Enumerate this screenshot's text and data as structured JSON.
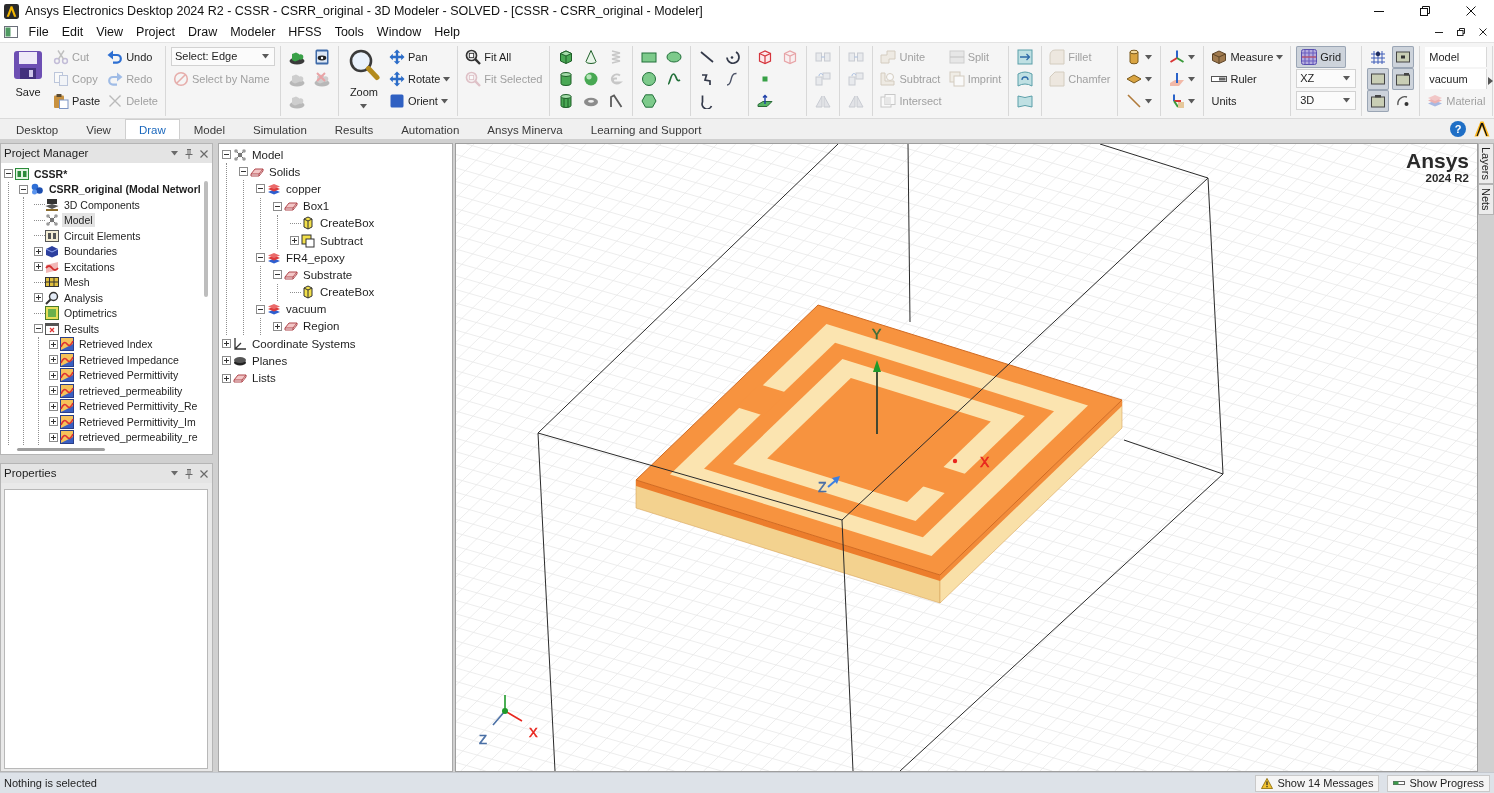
{
  "window": {
    "title": "Ansys Electronics Desktop 2024 R2 - CSSR - CSRR_original - 3D Modeler - SOLVED - [CSSR - CSRR_original - Modeler]"
  },
  "menu": [
    "File",
    "Edit",
    "View",
    "Project",
    "Draw",
    "Modeler",
    "HFSS",
    "Tools",
    "Window",
    "Help"
  ],
  "ribbon": [
    {
      "columns": [
        [
          {
            "kind": "large",
            "label": "Save",
            "disabled": false
          }
        ],
        [
          {
            "kind": "small",
            "label": "Cut",
            "disabled": true
          },
          {
            "kind": "small",
            "label": "Copy",
            "disabled": true
          },
          {
            "kind": "small",
            "label": "Paste",
            "disabled": false
          }
        ],
        [
          {
            "kind": "small",
            "label": "Undo",
            "disabled": false
          },
          {
            "kind": "small",
            "label": "Redo",
            "disabled": true
          },
          {
            "kind": "small",
            "label": "Delete",
            "disabled": true
          }
        ]
      ]
    },
    {
      "columns": [
        [
          {
            "kind": "select",
            "value": "Select: Edge"
          },
          {
            "kind": "small",
            "label": "Select by Name",
            "disabled": true
          }
        ]
      ]
    },
    {
      "columns": [
        [
          {
            "kind": "icon",
            "disabled": false
          },
          {
            "kind": "icon",
            "disabled": true
          },
          {
            "kind": "icon",
            "disabled": true
          }
        ],
        [
          {
            "kind": "icon",
            "disabled": false
          },
          {
            "kind": "icon",
            "disabled": true
          }
        ]
      ]
    },
    {
      "columns": [
        [
          {
            "kind": "large",
            "label": "Zoom",
            "disabled": false,
            "dropdown": true
          }
        ],
        [
          {
            "kind": "small",
            "label": "Pan",
            "disabled": false
          },
          {
            "kind": "small",
            "label": "Rotate",
            "disabled": false,
            "dropdown": true
          },
          {
            "kind": "small",
            "label": "Orient",
            "disabled": false,
            "dropdown": true
          }
        ]
      ]
    },
    {
      "columns": [
        [
          {
            "kind": "small",
            "label": "Fit All",
            "disabled": false
          },
          {
            "kind": "small",
            "label": "Fit Selected",
            "disabled": true
          }
        ]
      ]
    },
    {
      "columns": [
        [
          {
            "kind": "icon",
            "disabled": false
          },
          {
            "kind": "icon",
            "disabled": false
          },
          {
            "kind": "icon",
            "disabled": false
          }
        ],
        [
          {
            "kind": "icon",
            "disabled": false
          },
          {
            "kind": "icon",
            "disabled": false
          },
          {
            "kind": "icon",
            "disabled": false
          }
        ],
        [
          {
            "kind": "icon",
            "disabled": true
          },
          {
            "kind": "icon",
            "disabled": true
          },
          {
            "kind": "icon",
            "disabled": false
          }
        ]
      ]
    },
    {
      "columns": [
        [
          {
            "kind": "icon",
            "disabled": false
          },
          {
            "kind": "icon",
            "disabled": false
          },
          {
            "kind": "icon",
            "disabled": false
          }
        ],
        [
          {
            "kind": "icon",
            "disabled": false
          },
          {
            "kind": "icon",
            "disabled": false
          }
        ]
      ]
    },
    {
      "columns": [
        [
          {
            "kind": "icon",
            "disabled": false
          },
          {
            "kind": "icon",
            "disabled": false
          },
          {
            "kind": "icon",
            "disabled": false
          }
        ],
        [
          {
            "kind": "icon",
            "disabled": false
          },
          {
            "kind": "icon",
            "disabled": false
          }
        ]
      ]
    },
    {
      "columns": [
        [
          {
            "kind": "icon",
            "disabled": false
          },
          {
            "kind": "icon",
            "disabled": false
          },
          {
            "kind": "icon",
            "disabled": false
          }
        ],
        [
          {
            "kind": "icon",
            "disabled": true
          }
        ]
      ]
    },
    {
      "columns": [
        [
          {
            "kind": "icon",
            "disabled": true
          },
          {
            "kind": "icon",
            "disabled": true
          },
          {
            "kind": "icon",
            "disabled": true
          }
        ]
      ]
    },
    {
      "columns": [
        [
          {
            "kind": "icon",
            "disabled": true
          },
          {
            "kind": "icon",
            "disabled": true
          },
          {
            "kind": "icon",
            "disabled": true
          }
        ]
      ]
    },
    {
      "columns": [
        [
          {
            "kind": "small",
            "label": "Unite",
            "disabled": true
          },
          {
            "kind": "small",
            "label": "Subtract",
            "disabled": true
          },
          {
            "kind": "small",
            "label": "Intersect",
            "disabled": true
          }
        ],
        [
          {
            "kind": "small",
            "label": "Split",
            "disabled": true
          },
          {
            "kind": "small",
            "label": "Imprint",
            "disabled": true
          }
        ]
      ]
    },
    {
      "columns": [
        [
          {
            "kind": "icon",
            "disabled": false
          },
          {
            "kind": "icon",
            "disabled": false
          },
          {
            "kind": "icon",
            "disabled": false
          }
        ]
      ]
    },
    {
      "columns": [
        [
          {
            "kind": "small",
            "label": "Fillet",
            "disabled": true
          },
          {
            "kind": "small",
            "label": "Chamfer",
            "disabled": true
          }
        ]
      ]
    },
    {
      "columns": [
        [
          {
            "kind": "icon",
            "disabled": false,
            "dropdown": true
          },
          {
            "kind": "icon",
            "disabled": false,
            "dropdown": true
          },
          {
            "kind": "icon",
            "disabled": false,
            "dropdown": true
          }
        ]
      ]
    },
    {
      "columns": [
        [
          {
            "kind": "icon",
            "disabled": false,
            "dropdown": true
          },
          {
            "kind": "icon",
            "disabled": false,
            "dropdown": true
          },
          {
            "kind": "icon",
            "disabled": false,
            "dropdown": true
          }
        ]
      ]
    },
    {
      "columns": [
        [
          {
            "kind": "small",
            "label": "Measure",
            "disabled": false,
            "dropdown": true
          },
          {
            "kind": "small",
            "label": "Ruler",
            "disabled": false
          },
          {
            "kind": "plain",
            "label": "Units"
          }
        ]
      ]
    },
    {
      "columns": [
        [
          {
            "kind": "toggle",
            "label": "Grid",
            "on": true
          },
          {
            "kind": "select",
            "value": "XZ"
          },
          {
            "kind": "select",
            "value": "3D"
          }
        ]
      ]
    },
    {
      "columns": [
        [
          {
            "kind": "toggle",
            "on": false
          },
          {
            "kind": "toggle",
            "on": true
          },
          {
            "kind": "toggle",
            "on": true
          }
        ],
        [
          {
            "kind": "toggle",
            "on": true
          },
          {
            "kind": "toggle",
            "on": true
          },
          {
            "kind": "toggle",
            "on": false
          }
        ]
      ]
    },
    {
      "columns": [
        [
          {
            "kind": "field",
            "value": "Model"
          },
          {
            "kind": "field",
            "value": "vacuum"
          },
          {
            "kind": "small",
            "label": "Material",
            "disabled": true
          }
        ]
      ]
    }
  ],
  "ribbon_tabs": [
    {
      "label": "Desktop",
      "selected": false
    },
    {
      "label": "View",
      "selected": false
    },
    {
      "label": "Draw",
      "selected": true
    },
    {
      "label": "Model",
      "selected": false
    },
    {
      "label": "Simulation",
      "selected": false
    },
    {
      "label": "Results",
      "selected": false
    },
    {
      "label": "Automation",
      "selected": false
    },
    {
      "label": "Ansys Minerva",
      "selected": false
    },
    {
      "label": "Learning and Support",
      "selected": false
    }
  ],
  "help": "?",
  "project_manager": {
    "title": "Project Manager",
    "tree": [
      {
        "label": "CSSR*",
        "expanded": true,
        "selected": false,
        "children": [
          {
            "label": "CSRR_original (Modal Networl",
            "expanded": true,
            "selected": false,
            "children": [
              {
                "label": "3D Components",
                "selected": false
              },
              {
                "label": "Model",
                "selected": true
              },
              {
                "label": "Circuit Elements",
                "selected": false
              },
              {
                "label": "Boundaries",
                "expanded": false,
                "selected": false
              },
              {
                "label": "Excitations",
                "expanded": false,
                "selected": false
              },
              {
                "label": "Mesh",
                "selected": false
              },
              {
                "label": "Analysis",
                "expanded": false,
                "selected": false
              },
              {
                "label": "Optimetrics",
                "selected": false
              },
              {
                "label": "Results",
                "expanded": true,
                "selected": false,
                "children": [
                  {
                    "label": "Retrieved Index",
                    "expanded": false,
                    "selected": false
                  },
                  {
                    "label": "Retrieved Impedance",
                    "expanded": false,
                    "selected": false
                  },
                  {
                    "label": "Retrieved Permittivity",
                    "expanded": false,
                    "selected": false
                  },
                  {
                    "label": "retrieved_permeability",
                    "expanded": false,
                    "selected": false
                  },
                  {
                    "label": "Retrieved Permittivity_Re",
                    "expanded": false,
                    "selected": false
                  },
                  {
                    "label": "Retrieved Permittivity_Im",
                    "expanded": false,
                    "selected": false
                  },
                  {
                    "label": "retrieved_permeability_re",
                    "expanded": false,
                    "selected": false
                  }
                ]
              }
            ]
          }
        ]
      }
    ]
  },
  "properties": {
    "title": "Properties"
  },
  "model_tree": [
    {
      "label": "Model",
      "expanded": true,
      "selected": false,
      "children": [
        {
          "label": "Solids",
          "expanded": true,
          "selected": false,
          "children": [
            {
              "label": "copper",
              "expanded": true,
              "selected": false,
              "children": [
                {
                  "label": "Box1",
                  "expanded": true,
                  "selected": false,
                  "children": [
                    {
                      "label": "CreateBox",
                      "selected": false
                    },
                    {
                      "label": "Subtract",
                      "expanded": false,
                      "selected": false
                    }
                  ]
                }
              ]
            },
            {
              "label": "FR4_epoxy",
              "expanded": true,
              "selected": false,
              "children": [
                {
                  "label": "Substrate",
                  "expanded": true,
                  "selected": false,
                  "children": [
                    {
                      "label": "CreateBox",
                      "selected": false
                    }
                  ]
                }
              ]
            },
            {
              "label": "vacuum",
              "expanded": true,
              "selected": false,
              "children": [
                {
                  "label": "Region",
                  "expanded": false,
                  "selected": false
                }
              ]
            }
          ]
        }
      ]
    },
    {
      "label": "Coordinate Systems",
      "expanded": false,
      "selected": false
    },
    {
      "label": "Planes",
      "expanded": false,
      "selected": false
    },
    {
      "label": "Lists",
      "expanded": false,
      "selected": false
    }
  ],
  "viewport": {
    "brand": "Ansys",
    "version": "2024 R2",
    "axis_labels": [
      {
        "label": "Y",
        "color": "#3c6e3c"
      },
      {
        "label": "X",
        "color": "#e8261e"
      },
      {
        "label": "Z",
        "color": "#4a6fa5"
      }
    ],
    "triad_labels": [
      {
        "label": "Z",
        "color": "#4a6fa5"
      },
      {
        "label": "X",
        "color": "#e8261e"
      }
    ]
  },
  "side_tabs": [
    "Layers",
    "Nets"
  ],
  "status_bar": {
    "message": "Nothing is selected",
    "buttons": [
      "Show 14 Messages",
      "Show Progress"
    ]
  }
}
